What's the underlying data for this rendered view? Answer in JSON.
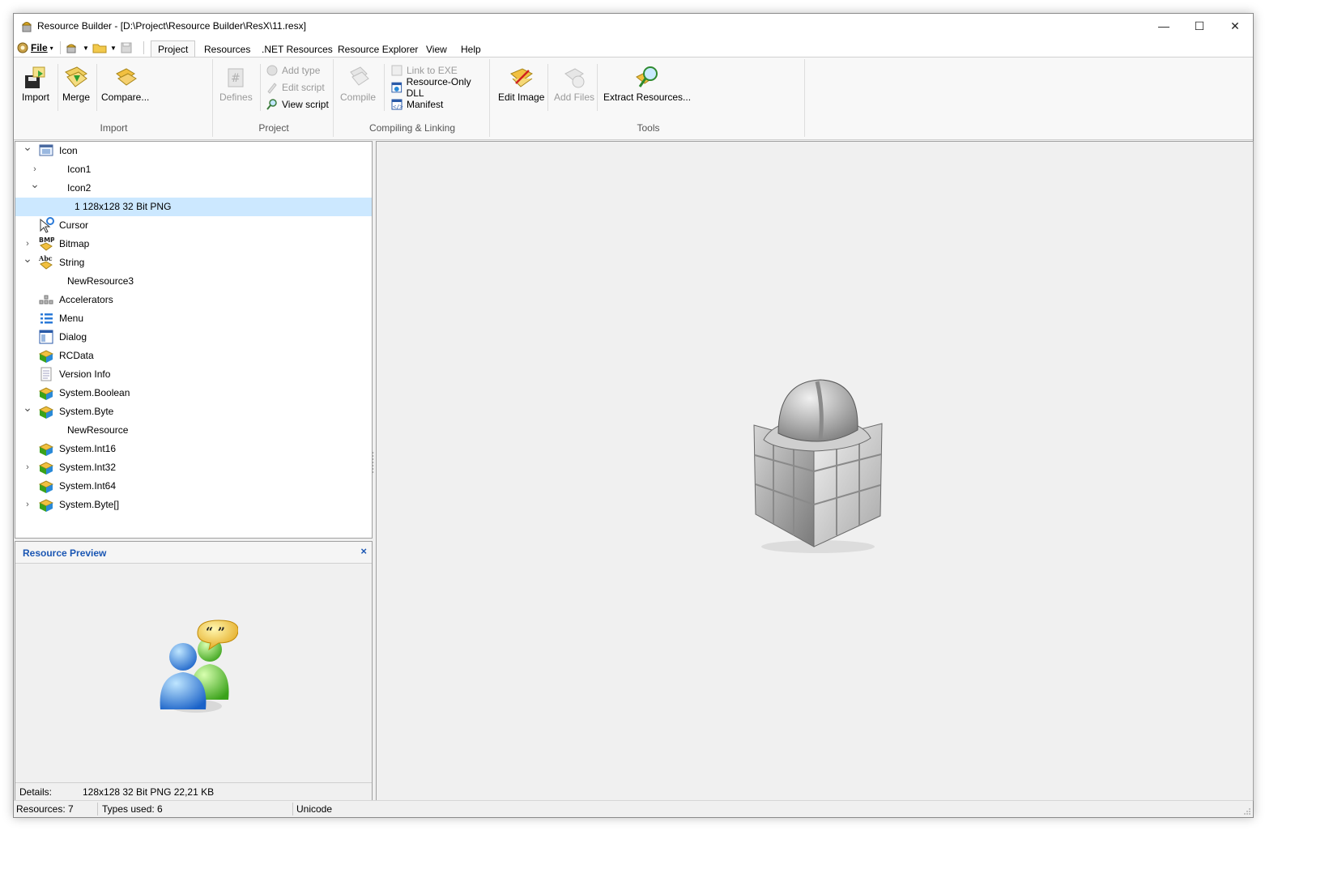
{
  "window": {
    "title": "Resource Builder - [D:\\Project\\Resource Builder\\ResX\\11.resx]",
    "controls": {
      "minimize": "—",
      "maximize": "☐",
      "close": "✕"
    }
  },
  "menubar": {
    "file_label": "File",
    "tabs": [
      {
        "label": "Project",
        "active": true
      },
      {
        "label": "Resources",
        "active": false
      },
      {
        "label": ".NET Resources",
        "active": false
      },
      {
        "label": "Resource Explorer",
        "active": false
      },
      {
        "label": "View",
        "active": false
      },
      {
        "label": "Help",
        "active": false
      }
    ]
  },
  "ribbon": {
    "groups": {
      "import": {
        "label": "Import",
        "buttons": {
          "import": "Import",
          "merge": "Merge",
          "compare": "Compare..."
        }
      },
      "project": {
        "label": "Project",
        "defines": "Defines",
        "add_type": "Add type",
        "edit_script": "Edit script",
        "view_script": "View script"
      },
      "compiling": {
        "label": "Compiling & Linking",
        "compile": "Compile",
        "link_to_exe": "Link to EXE",
        "resource_only_dll": "Resource-Only DLL",
        "manifest": "Manifest"
      },
      "tools": {
        "label": "Tools",
        "edit_image": "Edit Image",
        "add_files": "Add Files",
        "extract_resources": "Extract Resources..."
      }
    }
  },
  "tree": {
    "items": [
      {
        "label": "Icon",
        "expander": "open",
        "icon": "icon-type-icon",
        "level": 0
      },
      {
        "label": "Icon1",
        "expander": "closed",
        "icon": "",
        "level": 1
      },
      {
        "label": "Icon2",
        "expander": "open",
        "icon": "",
        "level": 1
      },
      {
        "label": "1 128x128 32 Bit PNG",
        "expander": "none",
        "icon": "",
        "level": 2,
        "selected": true
      },
      {
        "label": "Cursor",
        "expander": "none",
        "icon": "cursor-icon",
        "level": 0
      },
      {
        "label": "Bitmap",
        "expander": "closed",
        "icon": "bitmap-icon",
        "level": 0
      },
      {
        "label": "String",
        "expander": "open",
        "icon": "string-icon",
        "level": 0
      },
      {
        "label": "NewResource3",
        "expander": "none",
        "icon": "",
        "level": 1
      },
      {
        "label": "Accelerators",
        "expander": "none",
        "icon": "accelerators-icon",
        "level": 0
      },
      {
        "label": "Menu",
        "expander": "none",
        "icon": "menu-icon",
        "level": 0
      },
      {
        "label": "Dialog",
        "expander": "none",
        "icon": "dialog-icon",
        "level": 0
      },
      {
        "label": "RCData",
        "expander": "none",
        "icon": "data-cube-icon",
        "level": 0
      },
      {
        "label": "Version Info",
        "expander": "none",
        "icon": "version-info-icon",
        "level": 0
      },
      {
        "label": "System.Boolean",
        "expander": "none",
        "icon": "data-cube-icon",
        "level": 0
      },
      {
        "label": "System.Byte",
        "expander": "open",
        "icon": "data-cube-icon",
        "level": 0
      },
      {
        "label": "NewResource",
        "expander": "none",
        "icon": "",
        "level": 1
      },
      {
        "label": "System.Int16",
        "expander": "none",
        "icon": "data-cube-icon",
        "level": 0
      },
      {
        "label": "System.Int32",
        "expander": "closed",
        "icon": "data-cube-icon",
        "level": 0
      },
      {
        "label": "System.Int64",
        "expander": "none",
        "icon": "data-cube-icon",
        "level": 0
      },
      {
        "label": "System.Byte[]",
        "expander": "closed",
        "icon": "data-cube-icon",
        "level": 0
      }
    ]
  },
  "preview": {
    "title": "Resource Preview",
    "close": "×",
    "details_label": "Details:",
    "details_value": "128x128 32 Bit PNG 22,21 KB"
  },
  "statusbar": {
    "resources": "Resources: 7",
    "types_used": "Types used: 6",
    "encoding": "Unicode"
  },
  "colors": {
    "accent": "#1a56b3",
    "selection": "#cce8ff",
    "panel_bg": "#f0f0f0"
  }
}
